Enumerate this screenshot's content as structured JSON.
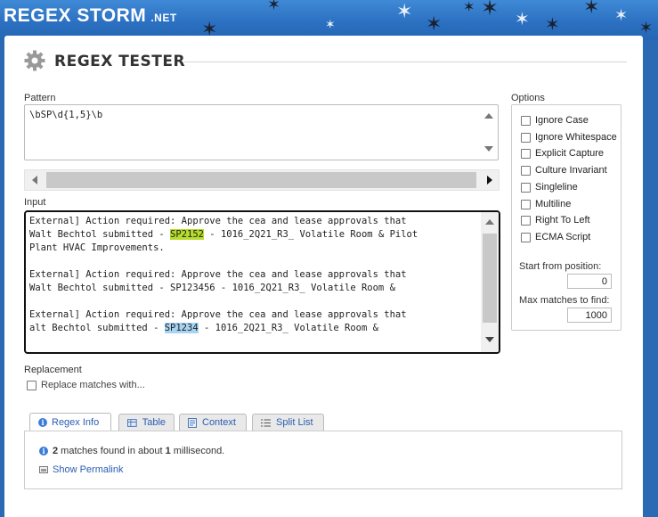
{
  "header": {
    "logo": "REGEX STORM",
    "logo_suffix": ".NET"
  },
  "title": "REGEX TESTER",
  "pattern": {
    "label": "Pattern",
    "value": "\\bSP\\d{1,5}\\b"
  },
  "input": {
    "label": "Input",
    "lines": [
      {
        "pre": "External] Action required: Approve the cea and lease approvals that",
        "match": "",
        "post": ""
      },
      {
        "pre": "Walt Bechtol submitted - ",
        "match": "SP2152",
        "post": " - 1016_2Q21_R3_ Volatile Room & Pilot"
      },
      {
        "pre": "Plant HVAC Improvements.",
        "match": "",
        "post": ""
      },
      {
        "pre": "",
        "match": "",
        "post": ""
      },
      {
        "pre": "External] Action required: Approve the cea and lease approvals that",
        "match": "",
        "post": ""
      },
      {
        "pre": "Walt Bechtol submitted - SP123456 - 1016_2Q21_R3_ Volatile Room &",
        "match": "",
        "post": ""
      },
      {
        "pre": "",
        "match": "",
        "post": ""
      },
      {
        "pre": "External] Action required: Approve the cea and lease approvals that",
        "match": "",
        "post": ""
      },
      {
        "pre": "alt Bechtol submitted - ",
        "match": "SP1234",
        "post": " - 1016_2Q21_R3_ Volatile Room &"
      }
    ]
  },
  "options": {
    "label": "Options",
    "items": [
      "Ignore Case",
      "Ignore Whitespace",
      "Explicit Capture",
      "Culture Invariant",
      "Singleline",
      "Multiline",
      "Right To Left",
      "ECMA Script"
    ],
    "start_label": "Start from position:",
    "start_value": "0",
    "max_label": "Max matches to find:",
    "max_value": "1000"
  },
  "replacement": {
    "label": "Replacement",
    "checkbox_label": "Replace matches with..."
  },
  "tabs": [
    "Regex Info",
    "Table",
    "Context",
    "Split List"
  ],
  "result": {
    "count": "2",
    "text_mid": " matches found in about ",
    "time": "1",
    "text_end": " millisecond.",
    "permalink": "Show Permalink"
  },
  "colors": {
    "match1": "#b6dc2c",
    "match2": "#a8d4f4",
    "link": "#2a5db0",
    "header": "#2b6fc0"
  }
}
